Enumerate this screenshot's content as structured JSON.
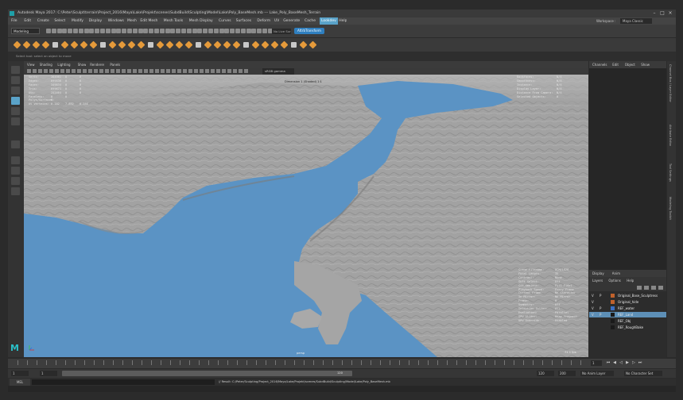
{
  "titlebar": {
    "title": "Autodesk Maya 2017: C:\\Peter\\Sculpt\\terrain\\Project_2016\\Maya\\Lake\\Projekt\\scenes\\SubdBuild\\Sculpting\\Model\\Lake\\Poly_BaseMesh.mb  ---  Lake_Poly_BaseMesh_Terrain",
    "workspace_label": "Workspace :",
    "workspace_value": "Maya Classic"
  },
  "menubar": {
    "items": [
      "File",
      "Edit",
      "Create",
      "Select",
      "Modify",
      "Display",
      "Windows",
      "Mesh",
      "Edit Mesh",
      "Mesh Tools",
      "Mesh Display",
      "Curves",
      "Surfaces",
      "Deform",
      "UV",
      "Generate",
      "Cache",
      "Lookdev",
      "Help"
    ],
    "highlighted": "Lookdev"
  },
  "statusline": {
    "mode": "Modeling",
    "camera_field": "No Live Surface",
    "tab_pill": "AttrbTransform"
  },
  "helpline_top": "Select tool: select an object to move",
  "viewport": {
    "menus": [
      "View",
      "Shading",
      "Lighting",
      "Show",
      "Renderer",
      "Panels"
    ],
    "gamma_field": "sRGB gamma",
    "camera_label": "Dimension 1 (Shaded) 1:1",
    "persp_label": "persp",
    "hud_left": [
      [
        "Verts:",
        "264981",
        "0",
        "0"
      ],
      [
        "Edges:",
        "699536",
        "0",
        "0"
      ],
      [
        "Faces:",
        "349834",
        "0",
        "0"
      ],
      [
        "Tris:",
        "699671",
        "0",
        "0"
      ],
      [
        "UVs:",
        "252464",
        "0",
        "0"
      ],
      [
        "",
        "",
        "",
        ""
      ],
      [
        "Faceless:",
        "0",
        "0",
        ""
      ],
      [
        "Polys/Surfaces:",
        "0",
        "",
        ""
      ],
      [
        "UV Vertexes:",
        "0.182",
        "7.892",
        "0.156"
      ]
    ],
    "hud_top_right": [
      [
        "Backfaces:",
        "N/A"
      ],
      [
        "Smoothness:",
        "N/A"
      ],
      [
        "Instance:",
        "N/A"
      ],
      [
        "Display Layer:",
        "N/A"
      ],
      [
        "Distance From Camera:",
        "N/A"
      ],
      [
        "Selected Objects:",
        "0"
      ]
    ],
    "hud_bottom_right": [
      [
        "Scene Filename:",
        "OCM/1920"
      ],
      [
        "Focal Length:",
        "35"
      ],
      [
        "Contrast:",
        "None"
      ],
      [
        "Soft Select:",
        "Off"
      ],
      [
        "Sub-Ambient:",
        "Full Fidel"
      ],
      [
        "Playback Speed:",
        "Every Frame"
      ],
      [
        "Current Frame:",
        "No Character"
      ],
      [
        "In Mirror:",
        "No Mirror"
      ],
      [
        "Frame:",
        "0"
      ],
      [
        "Symmetry:",
        "Off"
      ],
      [
        "Selection Filter:",
        "All"
      ],
      [
        "Evaluation:",
        "Parallel"
      ],
      [
        "GPU Slider:",
        "Heap fragment"
      ],
      [
        "GPU Override:",
        "Enabled"
      ]
    ],
    "fps": "71.1 fps"
  },
  "right_panel": {
    "tabs": [
      "Channels",
      "Edit",
      "Object",
      "Show"
    ],
    "layer_tabs": [
      "Display",
      "Anim"
    ],
    "layer_menus": [
      "Layers",
      "Options",
      "Help"
    ],
    "layers": [
      {
        "v": "V",
        "p": "P",
        "color": "#c0612b",
        "name": "Original_Base_Sculptress",
        "selected": false
      },
      {
        "v": "V",
        "p": "",
        "color": "#c0612b",
        "name": "Original_hide",
        "selected": false
      },
      {
        "v": "V",
        "p": "P",
        "color": "#3a6fc4",
        "name": "REF_water",
        "selected": false
      },
      {
        "v": "V",
        "p": "P",
        "color": "#1a1a1a",
        "name": "REF_Land",
        "selected": true
      },
      {
        "v": "",
        "p": "",
        "color": "#1a1a1a",
        "name": "REF_Obj",
        "selected": false
      },
      {
        "v": "",
        "p": "",
        "color": "#1a1a1a",
        "name": "REF_RoughBake",
        "selected": false
      }
    ],
    "edge_tabs": [
      "Channel Box / Layer Editor",
      "Attribute Editor",
      "Tool Settings",
      "Modeling Toolkit"
    ]
  },
  "timeslider": {
    "start_field": "1",
    "end_field": "1",
    "range_start": "1",
    "range_end": "120",
    "range_label": "120",
    "anim_end": "200",
    "no_anim_layer": "No Anim Layer",
    "no_character": "No Character Set"
  },
  "cmdline": {
    "label": "MEL",
    "result": "// Result: C:/Peter/Sculpting/Project_2016/Maya/Lake/Projekt/scenes/SubdBuild/Sculpting/Model/Lake/Poly_BaseMesh.mb"
  },
  "colors": {
    "water": "#5b93c4",
    "land": "#9c9c9c",
    "accent": "#5aa3c9"
  }
}
